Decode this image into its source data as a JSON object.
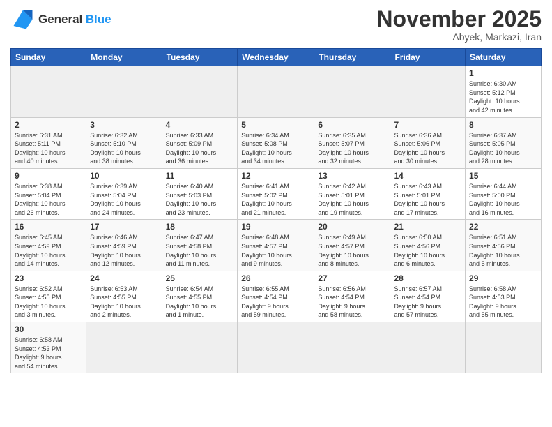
{
  "logo": {
    "line1": "General",
    "line2": "Blue"
  },
  "title": "November 2025",
  "location": "Abyek, Markazi, Iran",
  "days_of_week": [
    "Sunday",
    "Monday",
    "Tuesday",
    "Wednesday",
    "Thursday",
    "Friday",
    "Saturday"
  ],
  "weeks": [
    [
      {
        "day": null,
        "info": null
      },
      {
        "day": null,
        "info": null
      },
      {
        "day": null,
        "info": null
      },
      {
        "day": null,
        "info": null
      },
      {
        "day": null,
        "info": null
      },
      {
        "day": null,
        "info": null
      },
      {
        "day": "1",
        "info": "Sunrise: 6:30 AM\nSunset: 5:12 PM\nDaylight: 10 hours\nand 42 minutes."
      }
    ],
    [
      {
        "day": "2",
        "info": "Sunrise: 6:31 AM\nSunset: 5:11 PM\nDaylight: 10 hours\nand 40 minutes."
      },
      {
        "day": "3",
        "info": "Sunrise: 6:32 AM\nSunset: 5:10 PM\nDaylight: 10 hours\nand 38 minutes."
      },
      {
        "day": "4",
        "info": "Sunrise: 6:33 AM\nSunset: 5:09 PM\nDaylight: 10 hours\nand 36 minutes."
      },
      {
        "day": "5",
        "info": "Sunrise: 6:34 AM\nSunset: 5:08 PM\nDaylight: 10 hours\nand 34 minutes."
      },
      {
        "day": "6",
        "info": "Sunrise: 6:35 AM\nSunset: 5:07 PM\nDaylight: 10 hours\nand 32 minutes."
      },
      {
        "day": "7",
        "info": "Sunrise: 6:36 AM\nSunset: 5:06 PM\nDaylight: 10 hours\nand 30 minutes."
      },
      {
        "day": "8",
        "info": "Sunrise: 6:37 AM\nSunset: 5:05 PM\nDaylight: 10 hours\nand 28 minutes."
      }
    ],
    [
      {
        "day": "9",
        "info": "Sunrise: 6:38 AM\nSunset: 5:04 PM\nDaylight: 10 hours\nand 26 minutes."
      },
      {
        "day": "10",
        "info": "Sunrise: 6:39 AM\nSunset: 5:04 PM\nDaylight: 10 hours\nand 24 minutes."
      },
      {
        "day": "11",
        "info": "Sunrise: 6:40 AM\nSunset: 5:03 PM\nDaylight: 10 hours\nand 23 minutes."
      },
      {
        "day": "12",
        "info": "Sunrise: 6:41 AM\nSunset: 5:02 PM\nDaylight: 10 hours\nand 21 minutes."
      },
      {
        "day": "13",
        "info": "Sunrise: 6:42 AM\nSunset: 5:01 PM\nDaylight: 10 hours\nand 19 minutes."
      },
      {
        "day": "14",
        "info": "Sunrise: 6:43 AM\nSunset: 5:01 PM\nDaylight: 10 hours\nand 17 minutes."
      },
      {
        "day": "15",
        "info": "Sunrise: 6:44 AM\nSunset: 5:00 PM\nDaylight: 10 hours\nand 16 minutes."
      }
    ],
    [
      {
        "day": "16",
        "info": "Sunrise: 6:45 AM\nSunset: 4:59 PM\nDaylight: 10 hours\nand 14 minutes."
      },
      {
        "day": "17",
        "info": "Sunrise: 6:46 AM\nSunset: 4:59 PM\nDaylight: 10 hours\nand 12 minutes."
      },
      {
        "day": "18",
        "info": "Sunrise: 6:47 AM\nSunset: 4:58 PM\nDaylight: 10 hours\nand 11 minutes."
      },
      {
        "day": "19",
        "info": "Sunrise: 6:48 AM\nSunset: 4:57 PM\nDaylight: 10 hours\nand 9 minutes."
      },
      {
        "day": "20",
        "info": "Sunrise: 6:49 AM\nSunset: 4:57 PM\nDaylight: 10 hours\nand 8 minutes."
      },
      {
        "day": "21",
        "info": "Sunrise: 6:50 AM\nSunset: 4:56 PM\nDaylight: 10 hours\nand 6 minutes."
      },
      {
        "day": "22",
        "info": "Sunrise: 6:51 AM\nSunset: 4:56 PM\nDaylight: 10 hours\nand 5 minutes."
      }
    ],
    [
      {
        "day": "23",
        "info": "Sunrise: 6:52 AM\nSunset: 4:55 PM\nDaylight: 10 hours\nand 3 minutes."
      },
      {
        "day": "24",
        "info": "Sunrise: 6:53 AM\nSunset: 4:55 PM\nDaylight: 10 hours\nand 2 minutes."
      },
      {
        "day": "25",
        "info": "Sunrise: 6:54 AM\nSunset: 4:55 PM\nDaylight: 10 hours\nand 1 minute."
      },
      {
        "day": "26",
        "info": "Sunrise: 6:55 AM\nSunset: 4:54 PM\nDaylight: 9 hours\nand 59 minutes."
      },
      {
        "day": "27",
        "info": "Sunrise: 6:56 AM\nSunset: 4:54 PM\nDaylight: 9 hours\nand 58 minutes."
      },
      {
        "day": "28",
        "info": "Sunrise: 6:57 AM\nSunset: 4:54 PM\nDaylight: 9 hours\nand 57 minutes."
      },
      {
        "day": "29",
        "info": "Sunrise: 6:58 AM\nSunset: 4:53 PM\nDaylight: 9 hours\nand 55 minutes."
      }
    ],
    [
      {
        "day": "30",
        "info": "Sunrise: 6:58 AM\nSunset: 4:53 PM\nDaylight: 9 hours\nand 54 minutes."
      },
      {
        "day": null,
        "info": null
      },
      {
        "day": null,
        "info": null
      },
      {
        "day": null,
        "info": null
      },
      {
        "day": null,
        "info": null
      },
      {
        "day": null,
        "info": null
      },
      {
        "day": null,
        "info": null
      }
    ]
  ]
}
